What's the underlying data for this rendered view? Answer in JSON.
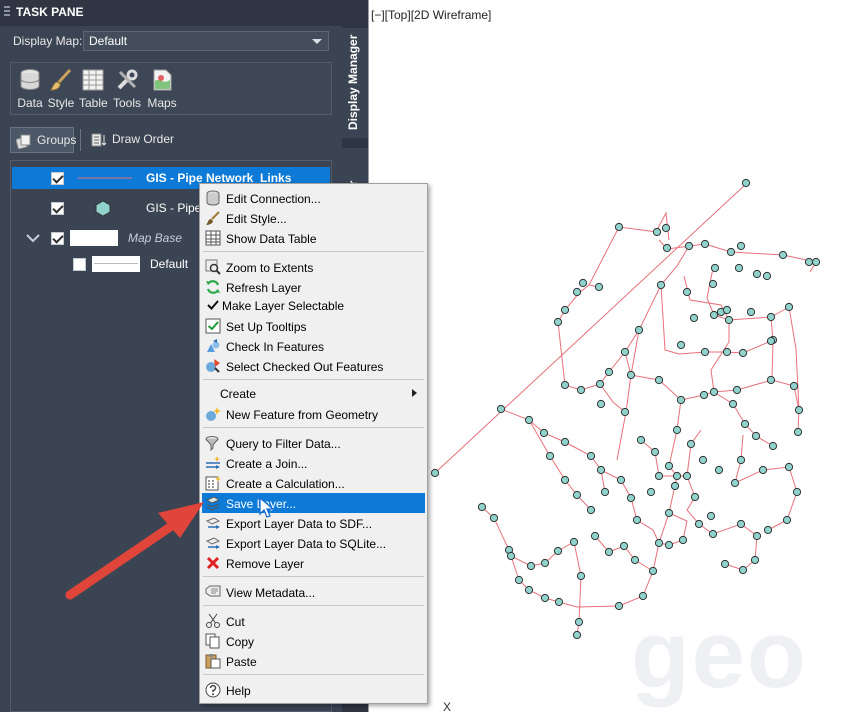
{
  "task_pane": {
    "title": "TASK PANE",
    "display_map_label": "Display Map:",
    "display_map_value": "Default",
    "toolbar": [
      "Data",
      "Style",
      "Table",
      "Tools",
      "Maps"
    ],
    "tabs": {
      "groups": "Groups",
      "draw_order": "Draw Order"
    },
    "side_tabs": {
      "display_manager": "Display Manager",
      "second": "er"
    }
  },
  "layers": [
    {
      "name": "GIS - Pipe Network_Links",
      "checked": true,
      "selected": true
    },
    {
      "name": "GIS - Pipe",
      "checked": true,
      "selected": false
    },
    {
      "name": "Map Base",
      "checked": true,
      "selected": false
    },
    {
      "name": "Default",
      "checked": false,
      "selected": false
    }
  ],
  "drawing": {
    "view_label": "[−][Top][2D Wireframe]",
    "axis_label": "X",
    "watermark": "geo",
    "colors": {
      "pipe": "#e8707a",
      "node_fill": "#8fd3cc",
      "node_stroke": "#333333"
    }
  },
  "context_menu": {
    "items": [
      {
        "label": "Edit Connection...",
        "icon": "database-icon"
      },
      {
        "label": "Edit Style...",
        "icon": "brush-icon"
      },
      {
        "label": "Show Data Table",
        "icon": "table-icon"
      },
      {
        "label": "Zoom to Extents",
        "icon": "zoom-icon"
      },
      {
        "label": "Refresh Layer",
        "icon": "refresh-icon"
      },
      {
        "label": "Make Layer Selectable",
        "icon": "check-icon"
      },
      {
        "label": "Set Up Tooltips",
        "icon": "tooltip-check-icon"
      },
      {
        "label": "Check In Features",
        "icon": "check-in-icon"
      },
      {
        "label": "Select Checked Out Features",
        "icon": "checked-out-icon"
      },
      {
        "label": "Create",
        "icon": ""
      },
      {
        "label": "New Feature from Geometry",
        "icon": "new-feature-icon"
      },
      {
        "label": "Query to Filter Data...",
        "icon": "query-icon"
      },
      {
        "label": "Create a Join...",
        "icon": "join-icon"
      },
      {
        "label": "Create a Calculation...",
        "icon": "calculator-icon"
      },
      {
        "label": "Save Layer...",
        "icon": "save-layer-icon"
      },
      {
        "label": "Export Layer Data to SDF...",
        "icon": "export-sdf-icon"
      },
      {
        "label": "Export Layer Data to SQLite...",
        "icon": "export-sqlite-icon"
      },
      {
        "label": "Remove Layer",
        "icon": "remove-icon"
      },
      {
        "label": "View Metadata...",
        "icon": "metadata-icon"
      },
      {
        "label": "Cut",
        "icon": "cut-icon"
      },
      {
        "label": "Copy",
        "icon": "copy-icon"
      },
      {
        "label": "Paste",
        "icon": "paste-icon"
      },
      {
        "label": "Help",
        "icon": "help-icon"
      }
    ],
    "highlighted": "Save Layer..."
  }
}
